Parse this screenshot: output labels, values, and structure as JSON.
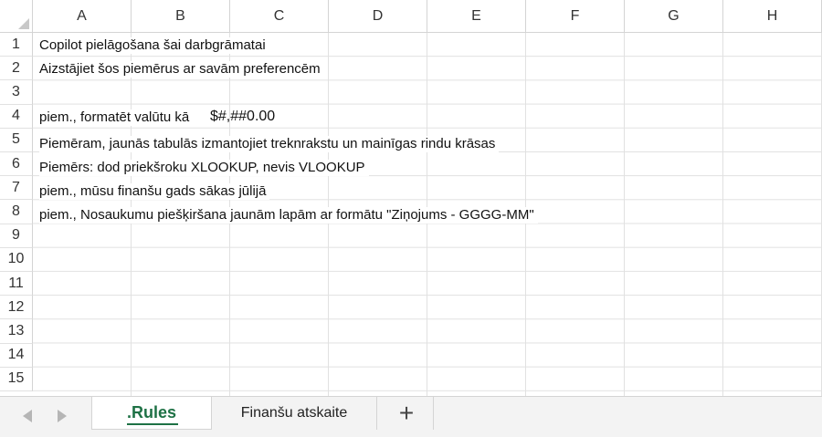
{
  "columns": [
    "A",
    "B",
    "C",
    "D",
    "E",
    "F",
    "G",
    "H"
  ],
  "rows": [
    "1",
    "2",
    "3",
    "4",
    "5",
    "6",
    "7",
    "8",
    "9",
    "10",
    "11",
    "12",
    "13",
    "14",
    "15"
  ],
  "cells": {
    "A1": "Copilot pielāgošana šai darbgrāmatai",
    "A2": "Aizstājiet šos piemērus ar savām preferencēm",
    "A4": "piem., formatēt valūtu kā",
    "C4": "$#,##0.00",
    "A5": "Piemēram, jaunās tabulās izmantojiet treknrakstu un mainīgas rindu krāsas",
    "A6": "Piemērs: dod priekšroku XLOOKUP, nevis VLOOKUP",
    "A7": "piem., mūsu finanšu gads sākas jūlijā",
    "A8": "piem., Nosaukumu piešķiršana jaunām lapām ar formātu \"Ziņojums - GGGG-MM\""
  },
  "sheet_tabs": {
    "active": ".Rules",
    "other": "Finanšu atskaite",
    "add_icon": "plus-icon",
    "accent_color": "#1e7145"
  }
}
